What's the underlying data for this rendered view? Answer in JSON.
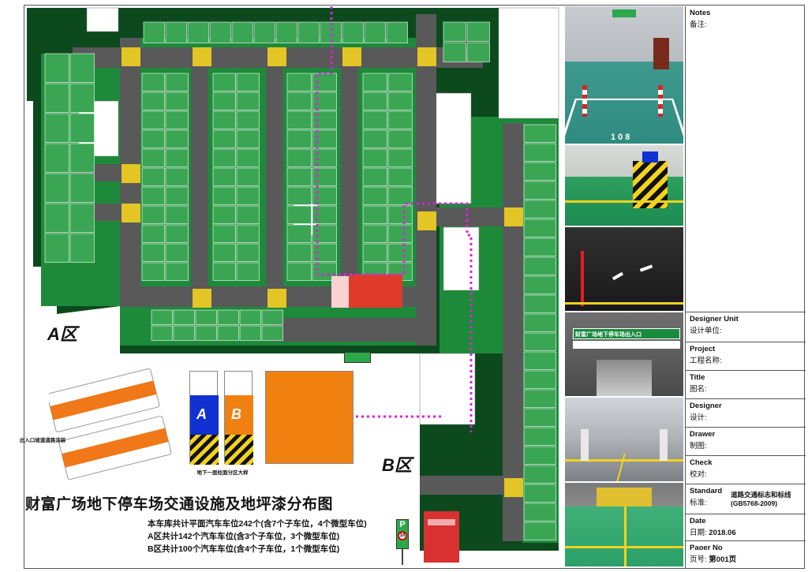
{
  "drawing": {
    "zone_a_label": "A区",
    "zone_b_label": "B区",
    "main_title": "财富广场地下停车场交通设施及地坪漆分布图",
    "stats": [
      "本车库共计平面汽车车位242个(含7个子车位，4个微型车位)",
      "A区共计142个汽车车位(含3个子车位，3个微型车位)",
      "B区共计100个汽车车位(含4个子车位，1个微型车位)"
    ],
    "entrance_caption": "出入口坡道道路涂装",
    "column_caption": "地下一层柱面分区大样",
    "column_letters": [
      "A",
      "B"
    ],
    "parking_sign_letter": "P",
    "speed_limit": "10",
    "colors": {
      "floor_green": "#1d8a3a",
      "dark_green": "#0c4a1e",
      "road_gray": "#595959",
      "stall_green": "#3aa653",
      "marker_yellow": "#f2d21f",
      "route_magenta": "#e020e0",
      "column_blue": "#1030d0",
      "column_orange": "#f08010"
    }
  },
  "title_block": {
    "notes_en": "Notes",
    "notes_cn": "备注:",
    "designer_unit_en": "Designer Unit",
    "designer_unit_cn": "设计单位:",
    "project_en": "Project",
    "project_cn": "工程名称:",
    "title_en": "Title",
    "title_cn": "图名:",
    "designer_en": "Designer",
    "designer_cn": "设计:",
    "drawer_en": "Drawer",
    "drawer_cn": "制图:",
    "check_en": "Check",
    "check_cn": "校对:",
    "standard_en": "Standard",
    "standard_cn": "标准:",
    "standard_value_1": "道路交通标志和标线",
    "standard_value_2": "(GB5768-2009)",
    "date_en": "Date",
    "date_cn": "日期:",
    "date_value": "2018.06",
    "page_en": "Paoer No",
    "page_cn": "页号:",
    "page_value": "第001页"
  },
  "photos": {
    "photo1_stall_number": "108",
    "photo4_banner": "财富广场地下停车场出入口"
  }
}
